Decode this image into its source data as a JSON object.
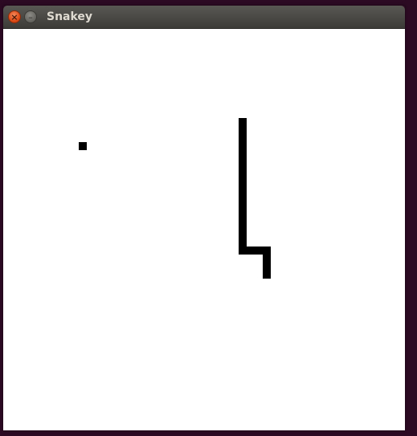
{
  "window": {
    "title": "Snakey",
    "close_icon": "close-icon",
    "minimize_icon": "minimize-icon"
  },
  "game": {
    "background_color": "#ffffff",
    "snake_color": "#000000",
    "food_color": "#000000",
    "snake_segments": [
      [
        37,
        14
      ],
      [
        37,
        15
      ],
      [
        37,
        16
      ],
      [
        37,
        17
      ],
      [
        37,
        18
      ],
      [
        37,
        19
      ],
      [
        37,
        20
      ],
      [
        37,
        21
      ],
      [
        37,
        22
      ],
      [
        37,
        23
      ],
      [
        37,
        24
      ],
      [
        37,
        25
      ],
      [
        37,
        26
      ],
      [
        37,
        27
      ],
      [
        37,
        28
      ],
      [
        37,
        29
      ],
      [
        37,
        30
      ],
      [
        38,
        30
      ],
      [
        39,
        30
      ],
      [
        40,
        30
      ],
      [
        40,
        31
      ],
      [
        40,
        32
      ],
      [
        40,
        33
      ]
    ],
    "food": [
      12,
      17
    ]
  }
}
